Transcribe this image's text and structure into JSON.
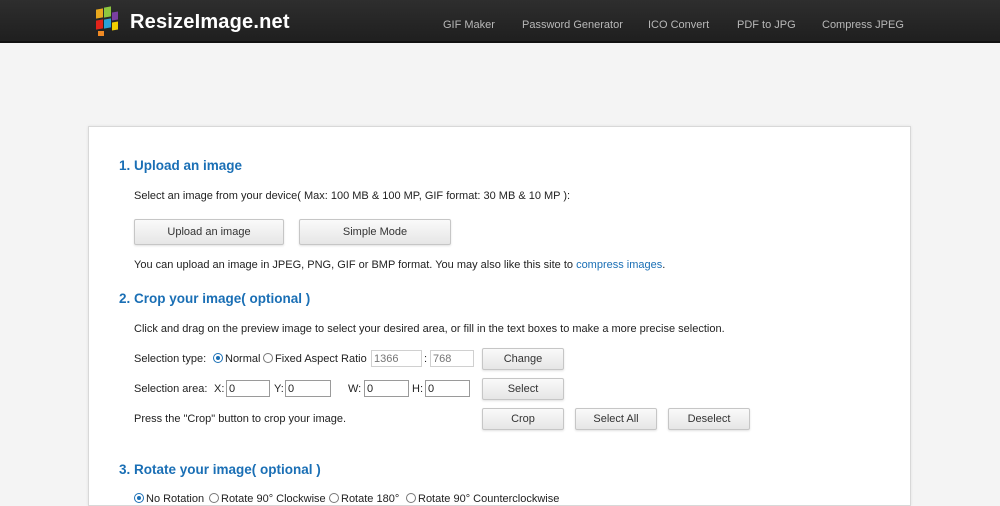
{
  "header": {
    "logo_text": "ResizeImage.net",
    "nav": [
      "GIF Maker",
      "Password Generator",
      "ICO Convert",
      "PDF to JPG",
      "Compress JPEG"
    ],
    "colors": {
      "bar": "#242424",
      "nav_text": "#b8b8b8",
      "logo_text": "#ffffff"
    }
  },
  "upload": {
    "heading": "1. Upload an image",
    "description": "Select an image from your device( Max: 100 MB & 100 MP, GIF format: 30 MB & 10 MP ):",
    "upload_button": "Upload an image",
    "simple_button": "Simple Mode",
    "formats_text": "You can upload an image in JPEG, PNG, GIF or BMP format. You may also like this site to ",
    "compress_link": "compress images",
    "formats_end": "."
  },
  "crop": {
    "heading": "2. Crop your image( optional )",
    "description": "Click and drag on the preview image to select your desired area, or fill in the text boxes to make a more precise selection.",
    "selection_type_label": "Selection type:",
    "option_normal": "Normal",
    "option_fixed": "Fixed Aspect Ratio",
    "ratio_width_placeholder": "1366",
    "ratio_separator": ":",
    "ratio_height_placeholder": "768",
    "change_button": "Change",
    "selection_area_label": "Selection area:",
    "x_label": "X:",
    "x_value": "0",
    "y_label": "Y:",
    "y_value": "0",
    "w_label": "W:",
    "w_value": "0",
    "h_label": "H:",
    "h_value": "0",
    "select_button": "Select",
    "crop_hint": "Press the \"Crop\" button to crop your image.",
    "crop_button": "Crop",
    "select_all_button": "Select All",
    "deselect_button": "Deselect"
  },
  "rotate": {
    "heading": "3. Rotate your image( optional )",
    "options": [
      "No Rotation",
      "Rotate 90° Clockwise",
      "Rotate 180°",
      "Rotate 90° Counterclockwise"
    ]
  },
  "accent_color": "#1a6fb5"
}
